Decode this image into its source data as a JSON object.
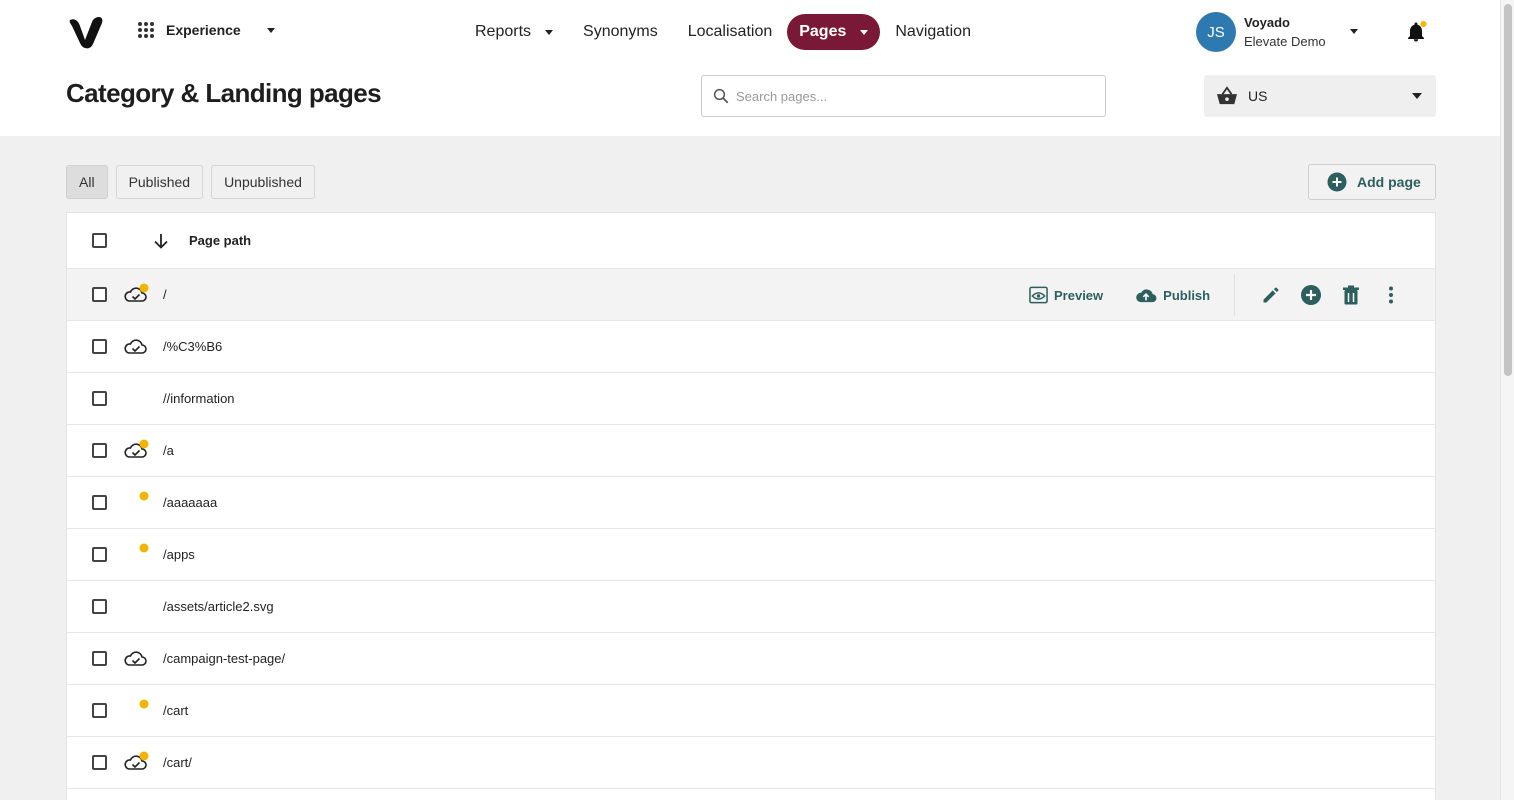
{
  "header": {
    "app_switcher_label": "Experience",
    "nav": [
      {
        "label": "Reports",
        "dropdown": true
      },
      {
        "label": "Synonyms",
        "dropdown": false
      },
      {
        "label": "Localisation",
        "dropdown": false
      },
      {
        "label": "Pages",
        "dropdown": true,
        "active": true
      },
      {
        "label": "Navigation",
        "dropdown": false
      }
    ],
    "user": {
      "initials": "JS",
      "name": "Voyado",
      "org": "Elevate Demo"
    },
    "notification_dot": true
  },
  "page": {
    "title": "Category & Landing pages",
    "search_placeholder": "Search pages...",
    "market": "US"
  },
  "filters": {
    "all": "All",
    "published": "Published",
    "unpublished": "Unpublished",
    "active": "All"
  },
  "add_page_label": "Add page",
  "table": {
    "column_header": "Page path",
    "row_actions": {
      "preview": "Preview",
      "publish": "Publish"
    },
    "rows": [
      {
        "path": "/",
        "status": "published-with-changes"
      },
      {
        "path": "/%C3%B6",
        "status": "published"
      },
      {
        "path": "//information",
        "status": "none"
      },
      {
        "path": "/a",
        "status": "published-with-changes"
      },
      {
        "path": "/aaaaaaa",
        "status": "unpublished-changes"
      },
      {
        "path": "/apps",
        "status": "unpublished-changes"
      },
      {
        "path": "/assets/article2.svg",
        "status": "none"
      },
      {
        "path": "/campaign-test-page/",
        "status": "published"
      },
      {
        "path": "/cart",
        "status": "unpublished-changes"
      },
      {
        "path": "/cart/",
        "status": "published-with-changes"
      }
    ]
  },
  "colors": {
    "accent": "#7a1838",
    "action": "#2d5f5e",
    "avatar": "#2e79b0",
    "dot": "#f5b400"
  }
}
